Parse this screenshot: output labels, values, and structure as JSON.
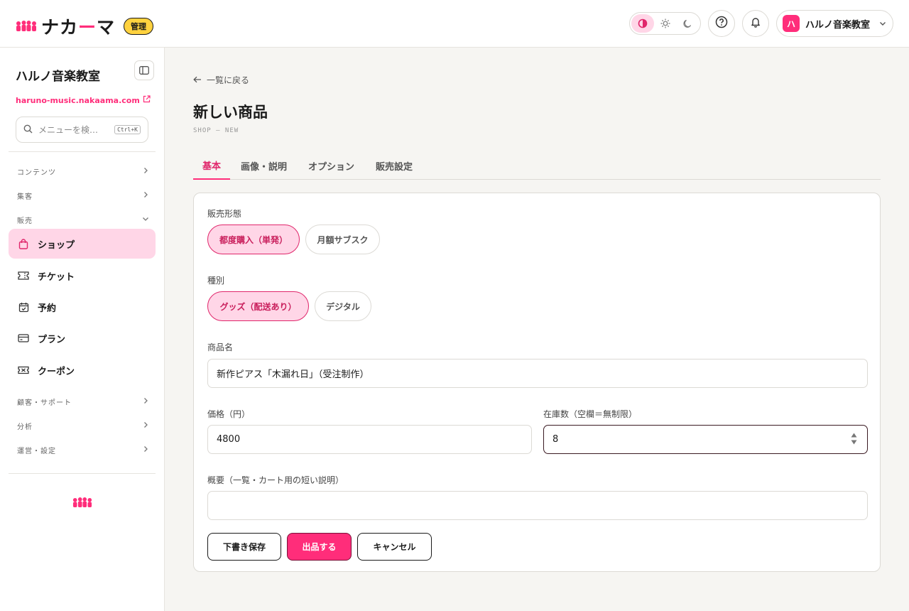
{
  "header": {
    "brand_name_pre": "ナカ",
    "brand_name_accent": "ー",
    "brand_name_post": "マ",
    "admin_badge": "管理",
    "account_avatar": "ハ",
    "account_name": "ハルノ音楽教室"
  },
  "sidebar": {
    "title": "ハルノ音楽教室",
    "url": "haruno-music.nakaama.com",
    "search_placeholder": "メニューを検…",
    "search_shortcut": "Ctrl+K",
    "groups": {
      "contents": "コンテンツ",
      "marketing": "集客",
      "sales": "販売",
      "customer": "顧客・サポート",
      "analytics": "分析",
      "settings": "運営・設定"
    },
    "items": {
      "shop": "ショップ",
      "ticket": "チケット",
      "reservation": "予約",
      "plan": "プラン",
      "coupon": "クーポン"
    }
  },
  "main": {
    "back_link": "一覧に戻る",
    "title": "新しい商品",
    "subtitle": "SHOP — NEW",
    "tabs": [
      "基本",
      "画像・説明",
      "オプション",
      "販売設定"
    ],
    "sales_type": {
      "label": "販売形態",
      "options": [
        "都度購入（単発）",
        "月額サブスク"
      ],
      "selected": "都度購入（単発）"
    },
    "kind": {
      "label": "種別",
      "options": [
        "グッズ（配送あり）",
        "デジタル"
      ],
      "selected": "グッズ（配送あり）"
    },
    "product_name": {
      "label": "商品名",
      "value": "新作ピアス「木漏れ日」（受注制作）"
    },
    "price": {
      "label": "価格（円）",
      "value": "4800"
    },
    "stock": {
      "label": "在庫数（空欄＝無制限）",
      "value": "8"
    },
    "summary": {
      "label": "概要（一覧・カート用の短い説明）",
      "value": ""
    },
    "buttons": {
      "draft": "下書き保存",
      "publish": "出品する",
      "cancel": "キャンセル"
    }
  },
  "colors": {
    "accent": "#ff2d7a",
    "accent_soft": "#ffd6e7",
    "badge": "#ffd23f"
  }
}
